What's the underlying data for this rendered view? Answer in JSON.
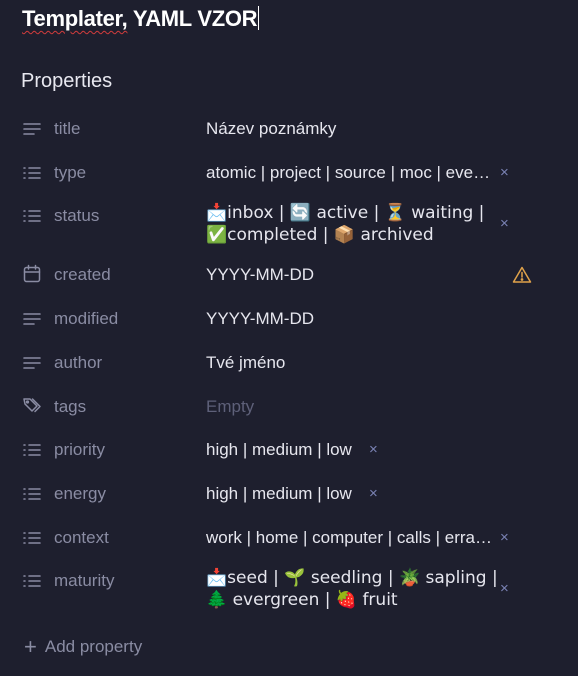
{
  "note": {
    "title_word1": "Templater,",
    "title_rest": " YAML VZOR"
  },
  "properties": {
    "heading": "Properties",
    "add_label": "Add property",
    "remove_glyph": "×",
    "rows": [
      {
        "key": "title",
        "icon": "text-lines-icon",
        "value": "Název poznámky"
      },
      {
        "key": "type",
        "icon": "list-icon",
        "value": "atomic | project | source | moc | evergreen"
      },
      {
        "key": "status",
        "icon": "list-icon",
        "value_line1": "📩inbox | 🔄 active | ⏳ waiting |",
        "value_line2": "✅completed | 📦 archived"
      },
      {
        "key": "created",
        "icon": "calendar-icon",
        "value": "YYYY-MM-DD",
        "badge_icon": "warning-triangle-icon"
      },
      {
        "key": "modified",
        "icon": "text-lines-icon",
        "value": "YYYY-MM-DD"
      },
      {
        "key": "author",
        "icon": "text-lines-icon",
        "value": "Tvé jméno"
      },
      {
        "key": "tags",
        "icon": "tags-icon",
        "value": "Empty"
      },
      {
        "key": "priority",
        "icon": "list-icon",
        "value": "high | medium | low"
      },
      {
        "key": "energy",
        "icon": "list-icon",
        "value": "high | medium | low"
      },
      {
        "key": "context",
        "icon": "list-icon",
        "value": "work | home | computer | calls | errands"
      },
      {
        "key": "maturity",
        "icon": "list-icon",
        "value_line1": "📩seed | 🌱 seedling | 🪴 sapling |",
        "value_line2": "🌲 evergreen | 🍓 fruit"
      }
    ]
  },
  "colors": {
    "background": "#1e1f2e",
    "muted_text": "#8a8ca3",
    "value_text": "#e6e6ee",
    "remove_x": "#7b83b5",
    "warning": "#e0a24a"
  }
}
